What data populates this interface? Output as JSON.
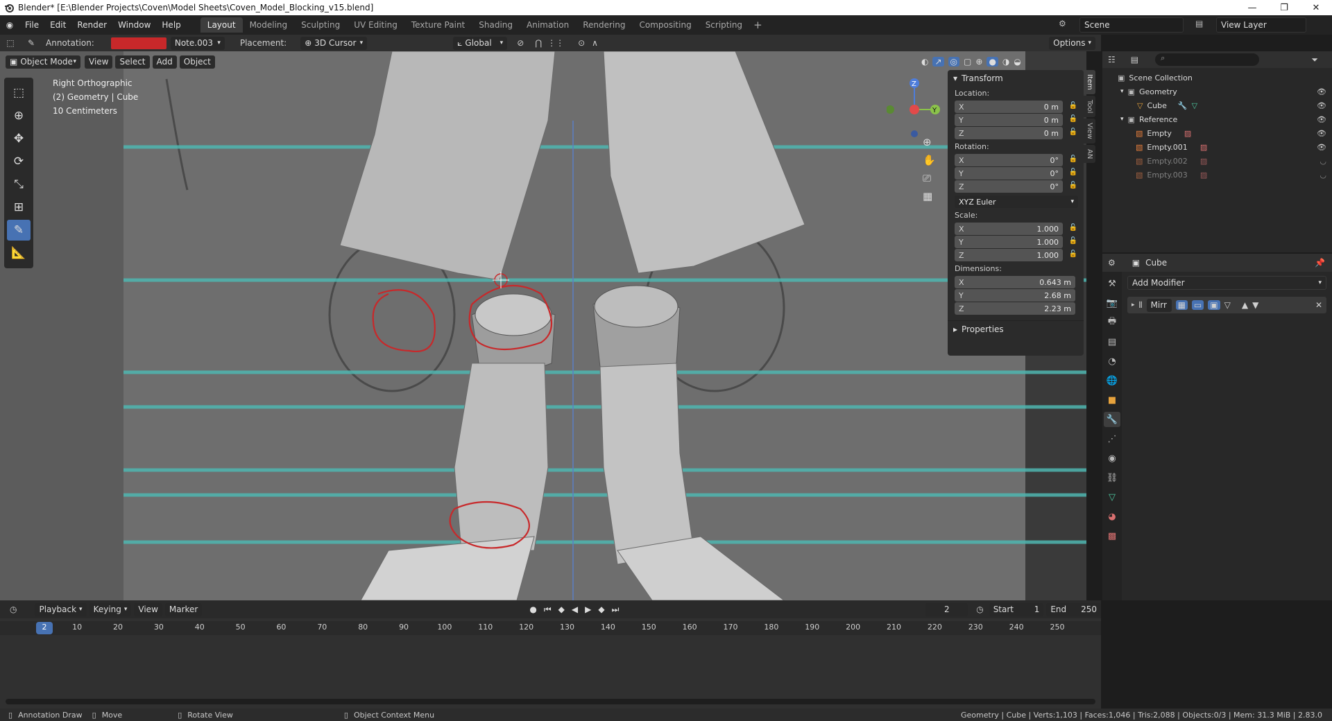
{
  "window": {
    "title": "Blender* [E:\\Blender Projects\\Coven\\Model Sheets\\Coven_Model_Blocking_v15.blend]",
    "controls": [
      "—",
      "❐",
      "✕"
    ]
  },
  "menu": [
    "File",
    "Edit",
    "Render",
    "Window",
    "Help"
  ],
  "workspaces": [
    "Layout",
    "Modeling",
    "Sculpting",
    "UV Editing",
    "Texture Paint",
    "Shading",
    "Animation",
    "Rendering",
    "Compositing",
    "Scripting"
  ],
  "active_workspace": "Layout",
  "scene": {
    "name": "Scene",
    "view_layer": "View Layer"
  },
  "tool_header": {
    "annotation_label": "Annotation:",
    "annotation_color": "#c8282a",
    "note": "Note.003",
    "placement_label": "Placement:",
    "placement": "3D Cursor",
    "orientation": "Global",
    "options": "Options"
  },
  "viewport_header": {
    "mode": "Object Mode",
    "menus": [
      "View",
      "Select",
      "Add",
      "Object"
    ]
  },
  "overlay_text": {
    "view": "Right Orthographic",
    "object": "(2) Geometry | Cube",
    "scale": "10 Centimeters"
  },
  "gizmo": {
    "z": "Z",
    "y": "Y"
  },
  "npanel": {
    "transform_title": "Transform",
    "location_label": "Location:",
    "location": [
      {
        "axis": "X",
        "value": "0 m"
      },
      {
        "axis": "Y",
        "value": "0 m"
      },
      {
        "axis": "Z",
        "value": "0 m"
      }
    ],
    "rotation_label": "Rotation:",
    "rotation": [
      {
        "axis": "X",
        "value": "0°"
      },
      {
        "axis": "Y",
        "value": "0°"
      },
      {
        "axis": "Z",
        "value": "0°"
      }
    ],
    "rotation_mode": "XYZ Euler",
    "scale_label": "Scale:",
    "scale": [
      {
        "axis": "X",
        "value": "1.000"
      },
      {
        "axis": "Y",
        "value": "1.000"
      },
      {
        "axis": "Z",
        "value": "1.000"
      }
    ],
    "dimensions_label": "Dimensions:",
    "dimensions": [
      {
        "axis": "X",
        "value": "0.643 m"
      },
      {
        "axis": "Y",
        "value": "2.68 m"
      },
      {
        "axis": "Z",
        "value": "2.23 m"
      }
    ],
    "properties_title": "Properties",
    "tabs": [
      "Item",
      "Tool",
      "View",
      "AN"
    ]
  },
  "outliner": {
    "root": "Scene Collection",
    "items": [
      {
        "label": "Geometry",
        "depth": 1,
        "dim": false
      },
      {
        "label": "Cube",
        "depth": 2,
        "dim": false
      },
      {
        "label": "Reference",
        "depth": 1,
        "dim": false
      },
      {
        "label": "Empty",
        "depth": 2,
        "dim": false
      },
      {
        "label": "Empty.001",
        "depth": 2,
        "dim": false
      },
      {
        "label": "Empty.002",
        "depth": 2,
        "dim": true
      },
      {
        "label": "Empty.003",
        "depth": 2,
        "dim": true
      }
    ]
  },
  "properties": {
    "object": "Cube",
    "add_modifier": "Add Modifier",
    "modifier_name": "Mirr"
  },
  "timeline": {
    "menus": [
      "Playback",
      "Keying",
      "View",
      "Marker"
    ],
    "current_frame": "2",
    "start_label": "Start",
    "start": "1",
    "end_label": "End",
    "end": "250",
    "ticks": [
      "2",
      "10",
      "20",
      "30",
      "40",
      "50",
      "60",
      "70",
      "80",
      "90",
      "100",
      "110",
      "120",
      "130",
      "140",
      "150",
      "160",
      "170",
      "180",
      "190",
      "200",
      "210",
      "220",
      "230",
      "240",
      "250"
    ]
  },
  "statusbar": {
    "left": [
      "Annotation Draw",
      "Move",
      "Rotate View",
      "Object Context Menu"
    ],
    "right": "Geometry | Cube | Verts:1,103 | Faces:1,046 | Tris:2,088 | Objects:0/3 | Mem: 31.3 MiB | 2.83.0"
  }
}
